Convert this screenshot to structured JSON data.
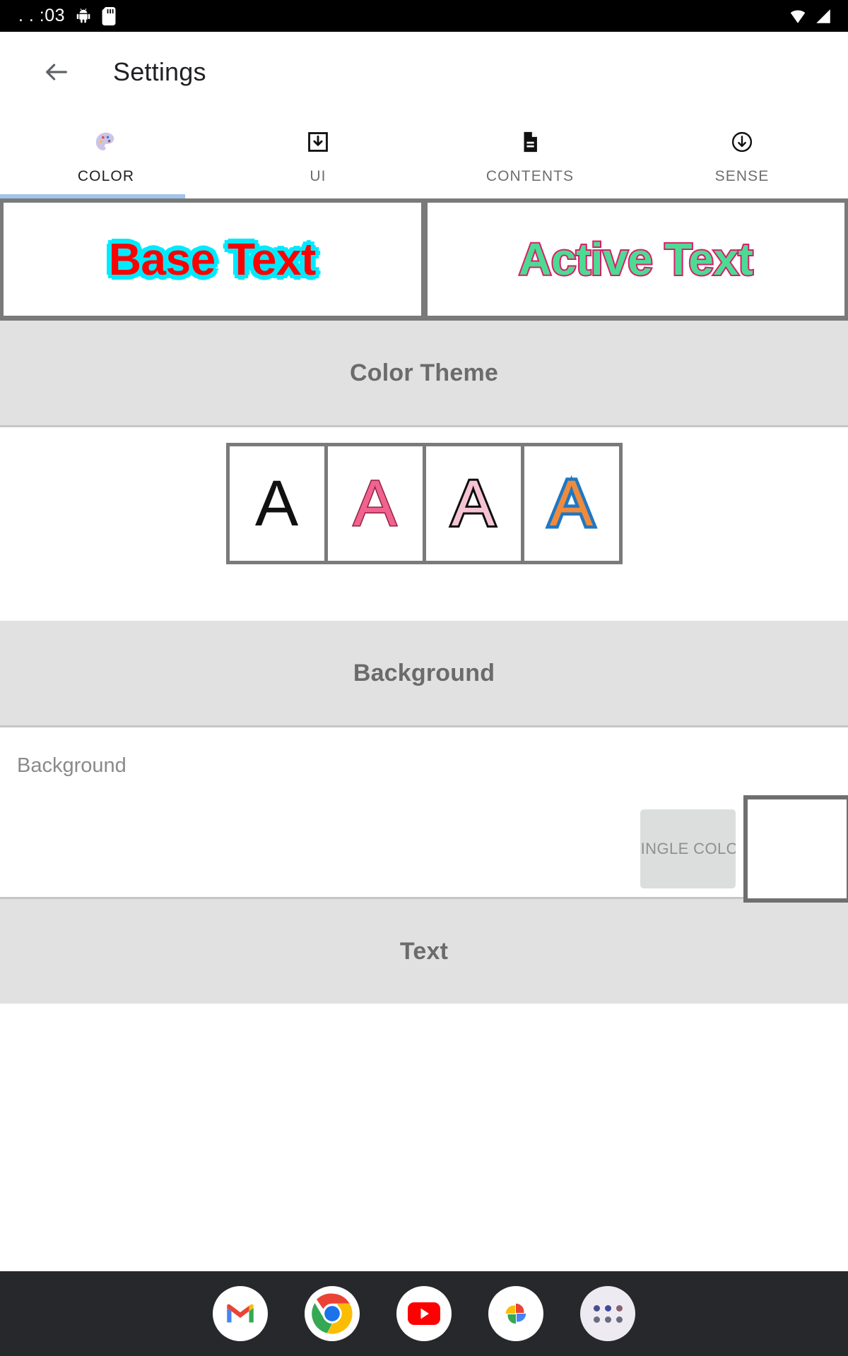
{
  "statusbar": {
    "time": ". . :03",
    "icons": [
      "android-bug-icon",
      "sd-card-icon",
      "wifi-icon",
      "signal-icon"
    ]
  },
  "appbar": {
    "back_icon": "back-arrow-icon",
    "title": "Settings"
  },
  "tabs": {
    "active_index": 0,
    "items": [
      {
        "label": "COLOR",
        "icon": "palette-icon"
      },
      {
        "label": "UI",
        "icon": "download-box-icon"
      },
      {
        "label": "CONTENTS",
        "icon": "document-icon"
      },
      {
        "label": "SENSE",
        "icon": "circle-down-arrow-icon"
      }
    ],
    "indicator_color": "#a2c4e8"
  },
  "preview": {
    "base": {
      "text": "Base Text",
      "fill_color": "#ff0000",
      "outline_color": "#00eaff"
    },
    "active": {
      "text": "Active Text",
      "fill_color": "#4ddb94",
      "outline_color": "#d61f69"
    }
  },
  "sections": {
    "color_theme": {
      "title": "Color Theme",
      "swatches": [
        {
          "glyph": "A",
          "fill_color": "#111111",
          "outline_color": "none"
        },
        {
          "glyph": "A",
          "fill_color": "#f2628f",
          "outline_color": "#8c2340"
        },
        {
          "glyph": "A",
          "fill_color": "#f6c3d4",
          "outline_color": "#0d0d0d"
        },
        {
          "glyph": "A",
          "fill_color": "#f08b3c",
          "outline_color": "#1f77c4"
        }
      ]
    },
    "background": {
      "title": "Background",
      "row_label": "Background",
      "mode_button": "SINGLE COLOR",
      "swatch_color": "#ffffff"
    },
    "text": {
      "title": "Text"
    }
  },
  "dock": {
    "items": [
      {
        "name": "gmail"
      },
      {
        "name": "chrome"
      },
      {
        "name": "youtube"
      },
      {
        "name": "google-photos"
      },
      {
        "name": "app-drawer"
      }
    ]
  }
}
